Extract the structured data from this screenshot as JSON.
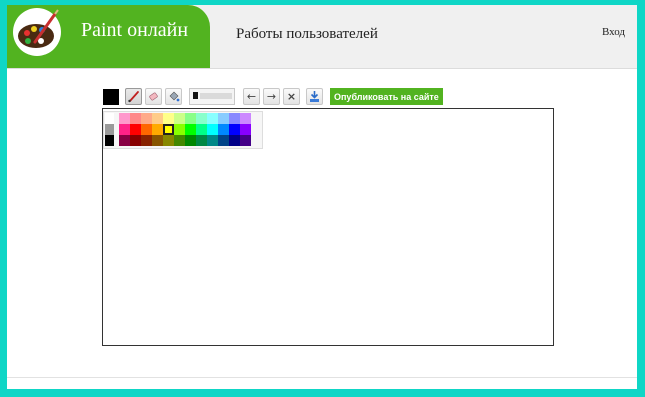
{
  "header": {
    "brand_name": "Paint онлайн",
    "nav_works": "Работы пользователей",
    "nav_login": "Вход"
  },
  "colors": {
    "brand_green": "#52b320",
    "frame_border": "#0fd6c6",
    "current_color": "#000000"
  },
  "toolbar": {
    "tools": [
      "brush-tool",
      "eraser-tool",
      "fill-tool"
    ],
    "active_tool": "brush-tool",
    "undo_icon": "←",
    "redo_icon": "→",
    "clear_icon": "×",
    "publish_label": "Опубликовать на сайте"
  },
  "palette": {
    "grays": [
      "#ffffff",
      "#9a9a9a",
      "#000000"
    ],
    "rows": [
      [
        "#ff99cc",
        "#ff8888",
        "#ffaa88",
        "#ffcc88",
        "#ffff88",
        "#ccff88",
        "#88ff88",
        "#88ffcc",
        "#88ffff",
        "#88ccff",
        "#8888ff",
        "#cc88ff"
      ],
      [
        "#ff2288",
        "#ff0000",
        "#ff6600",
        "#ffaa00",
        "#ffff00",
        "#88ff00",
        "#00ff00",
        "#00ff88",
        "#00ffff",
        "#0088ff",
        "#0000ff",
        "#8800ff"
      ],
      [
        "#880044",
        "#880000",
        "#882200",
        "#885500",
        "#888800",
        "#448800",
        "#008800",
        "#008844",
        "#008888",
        "#004488",
        "#000088",
        "#440088"
      ]
    ],
    "selected": "#ffff00"
  }
}
